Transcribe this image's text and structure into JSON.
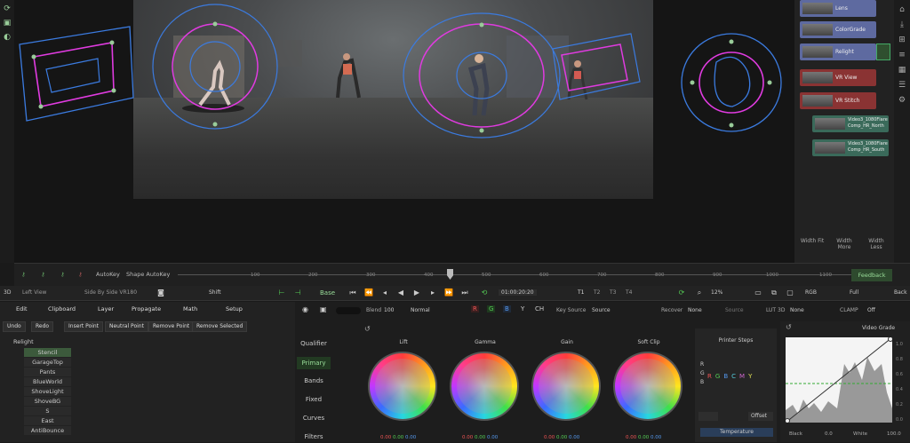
{
  "nodes": [
    {
      "label": "Lens",
      "color": "#5e6aa0"
    },
    {
      "label": "ColorGrade",
      "color": "#5e6aa0"
    },
    {
      "label": "Relight",
      "color": "#5e6aa0"
    },
    {
      "label": "VR View",
      "color": "#8a3333"
    },
    {
      "label": "VR Stitch",
      "color": "#8a3333"
    },
    {
      "label": "Video3_1080Flare Comp_HR_North",
      "color": "#3a6a5a"
    },
    {
      "label": "Video3_1080Flare Comp_HR_South",
      "color": "#3a6a5a"
    }
  ],
  "width_buttons": [
    "Width Fit",
    "Width More",
    "Width Less"
  ],
  "timeline": {
    "autokey": "AutoKey",
    "shape_autokey": "Shape AutoKey",
    "ticks": [
      "100",
      "200",
      "300",
      "400",
      "500",
      "600",
      "700",
      "800",
      "900",
      "1000",
      "1100",
      "1200",
      "1300"
    ],
    "feedback": "Feedback"
  },
  "controls": {
    "mode": "3D",
    "view": "Left View",
    "stereo": "Side By Side VR180",
    "shift": "Shift",
    "timecode": "01:00:20:20",
    "t_buttons": [
      "T1",
      "T2",
      "T3",
      "T4"
    ],
    "zoom": "12%",
    "colorspace": "RGB",
    "full": "Full",
    "back": "Back"
  },
  "left_panel": {
    "tabs": [
      "Edit",
      "Clipboard",
      "Layer",
      "Propagate",
      "Math",
      "Setup"
    ],
    "buttons": [
      "Undo",
      "Redo",
      "Insert Point",
      "Neutral Point",
      "Remove Point",
      "Remove Selected"
    ],
    "layers": [
      "Relight",
      "Stencil",
      "GarageTop",
      "Pants",
      "BlueWorld",
      "ShoveLight",
      "ShoveBG",
      "S",
      "East",
      "AntiBounce"
    ]
  },
  "center_panel": {
    "base": "Base",
    "blend_label": "Blend",
    "blend_value": "100",
    "blend_mode": "Normal",
    "channels": [
      "R",
      "G",
      "B",
      "Y",
      "CH"
    ],
    "key_source_label": "Key Source",
    "key_source": "Source",
    "recover_label": "Recover",
    "recover": "None",
    "source": "Source",
    "lut_label": "LUT 3D",
    "lut": "None",
    "clamp_label": "CLAMP",
    "clamp": "Off",
    "side_items": [
      "Qualifier",
      "Primary",
      "Bands",
      "Fixed",
      "Curves",
      "Filters"
    ],
    "wheels": [
      {
        "label": "Lift",
        "values": [
          "0.00",
          "0.00",
          "0.00"
        ]
      },
      {
        "label": "Gamma",
        "values": [
          "0.00",
          "0.00",
          "0.00"
        ]
      },
      {
        "label": "Gain",
        "values": [
          "0.00",
          "0.00",
          "0.00"
        ]
      },
      {
        "label": "Soft Clip",
        "values": [
          "0.00",
          "0.00",
          "0.00"
        ]
      }
    ],
    "printer_steps": "Printer Steps",
    "printer_letters": [
      "R",
      "G",
      "B",
      "C",
      "M",
      "Y"
    ],
    "printer_left": [
      "R",
      "G",
      "B"
    ],
    "offset": "Offset",
    "temperature": "Temperature",
    "scope_title": "Video Grade",
    "scope_ticks": [
      "1.0",
      "0.8",
      "0.6",
      "0.4",
      "0.2",
      "0.0"
    ],
    "black_label": "Black",
    "black_value": "0.0",
    "white_label": "White",
    "white_value": "100.0"
  }
}
